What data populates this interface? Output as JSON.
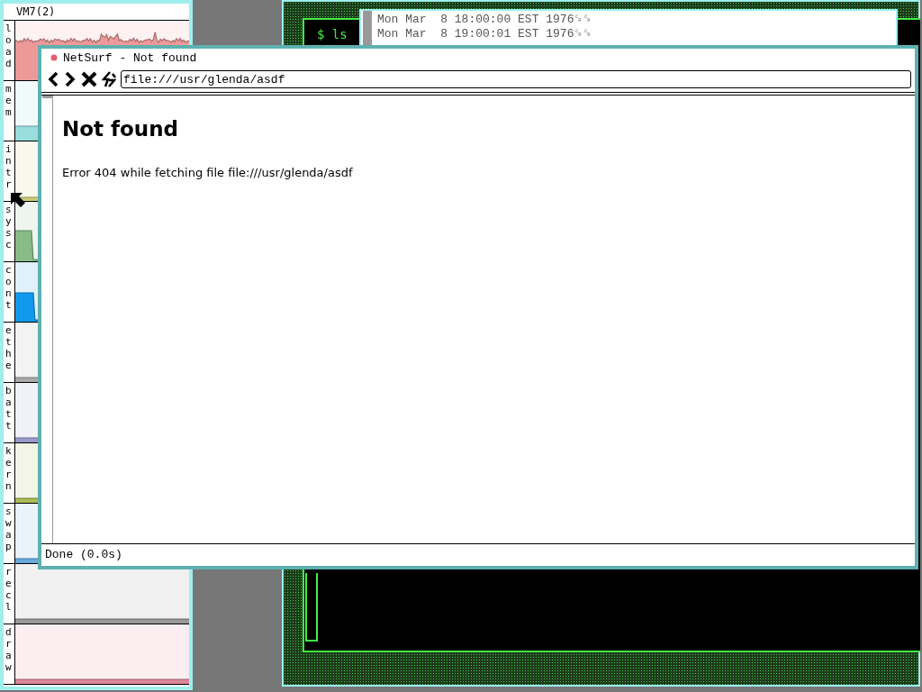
{
  "stats_window": {
    "title": "VM7(2)",
    "rows": [
      {
        "label": "load",
        "color": "#ee9999"
      },
      {
        "label": "mem",
        "color": "#99dddd"
      },
      {
        "label": "intr",
        "color": "#cccc77"
      },
      {
        "label": "sysc",
        "color": "#88bb88"
      },
      {
        "label": "cont",
        "color": "#1199ee"
      },
      {
        "label": "ethe",
        "color": "#aaaaaa"
      },
      {
        "label": "batt",
        "color": "#9999cc"
      },
      {
        "label": "kern",
        "color": "#aabb55"
      },
      {
        "label": "swap",
        "color": "#66aadd"
      },
      {
        "label": "recl",
        "color": "#999999"
      },
      {
        "label": "draw",
        "color": "#dd8899"
      }
    ]
  },
  "terminal_window": {
    "prompt": "$ ls",
    "date_window": {
      "lines": [
        "Mon Mar  8 18:00:00 EST 1976␍␍",
        "Mon Mar  8 19:00:01 EST 1976␍␍"
      ]
    }
  },
  "browser_window": {
    "title": "NetSurf - Not found",
    "url": "file:///usr/glenda/asdf",
    "heading": "Not found",
    "message": "Error 404 while fetching file file:///usr/glenda/asdf",
    "status": "Done (0.0s)"
  }
}
